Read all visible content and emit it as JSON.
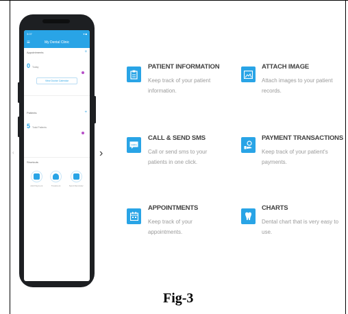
{
  "phone": {
    "status_left": "3:07",
    "status_right": "▾ ■",
    "app_title": "My Dental Clinic",
    "appointments_label": "Appointments",
    "appointments_count": "0",
    "appointments_sub": "Today",
    "calendar_button": "View Doctor Calendar",
    "patients_label": "Patients",
    "patients_count": "5",
    "patients_sub": "Total Patients",
    "shortcuts_label": "Shortcuts",
    "shortcuts": [
      "Add Payment",
      "Treatment",
      "Send Reminder"
    ]
  },
  "features": [
    {
      "title": "PATIENT INFORMATION",
      "desc1": "Keep track of your patient",
      "desc2": "information.",
      "icon": "clipboard-icon"
    },
    {
      "title": "ATTACH IMAGE",
      "desc1": "Attach images to your patient",
      "desc2": "records.",
      "icon": "image-icon"
    },
    {
      "title": "CALL & SEND SMS",
      "desc1": "Call or send sms to your",
      "desc2": "patients in one click.",
      "icon": "sms-icon"
    },
    {
      "title": "PAYMENT TRANSACTIONS",
      "desc1": "Keep track of your patient's",
      "desc2": "payments.",
      "icon": "payment-icon"
    },
    {
      "title": "APPOINTMENTS",
      "desc1": "Keep track of your",
      "desc2": "appointments.",
      "icon": "calendar-icon"
    },
    {
      "title": "CHARTS",
      "desc1": "Dental chart that is very easy to",
      "desc2": "use.",
      "icon": "tooth-icon"
    }
  ],
  "caption": "Fig-3",
  "colors": {
    "accent": "#29a4e6",
    "badge": "#b64fc8"
  }
}
